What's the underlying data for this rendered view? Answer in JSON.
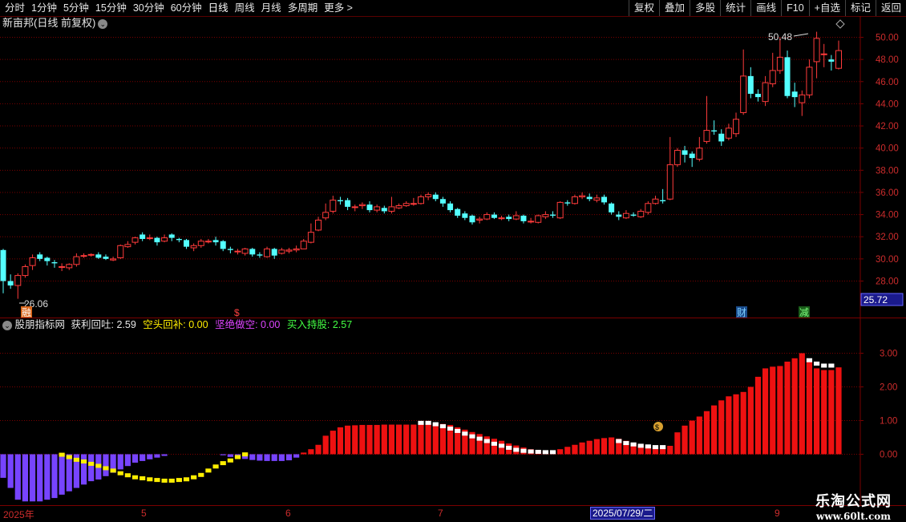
{
  "toolbar": {
    "periods": [
      "分时",
      "1分钟",
      "5分钟",
      "15分钟",
      "30分钟",
      "60分钟",
      "日线",
      "周线",
      "月线",
      "多周期",
      "更多 >"
    ],
    "right_buttons": [
      "复权",
      "叠加",
      "多股",
      "统计",
      "画线",
      "F10",
      "+自选",
      "标记",
      "返回"
    ]
  },
  "main_title": "新亩邦(日线 前复权)",
  "price_axis": {
    "ticks": [
      "50.00",
      "48.00",
      "46.00",
      "44.00",
      "42.00",
      "40.00",
      "38.00",
      "36.00",
      "34.00",
      "32.00",
      "30.00",
      "28.00"
    ],
    "current": "25.72"
  },
  "annotations": {
    "high": "50.48",
    "low": "26.06",
    "mark1": "融",
    "mark2": "$",
    "mark3": "财",
    "mark4": "减"
  },
  "indicator": {
    "name": "股朋指标网",
    "items": [
      {
        "label": "获利回吐:",
        "value": "2.59"
      },
      {
        "label": "空头回补:",
        "value": "0.00"
      },
      {
        "label": "坚绝做空:",
        "value": "0.00"
      },
      {
        "label": "买入持股:",
        "value": "2.57"
      }
    ],
    "axis": [
      "3.00",
      "2.00",
      "1.00",
      "0.00"
    ]
  },
  "date_axis": {
    "labels": [
      "2025年",
      "5",
      "6",
      "7",
      "9"
    ],
    "crosshair": "2025/07/29/二"
  },
  "watermark": {
    "line1": "乐淘公式网",
    "line2": "www.60lt.com"
  },
  "colors": {
    "up": "#ff3b3b",
    "down": "#54ffff",
    "purple": "#7744ff",
    "yellow": "#ffee00",
    "grid": "#7a0000"
  },
  "chart_data": {
    "type": "candlestick",
    "ylim": [
      26,
      51
    ],
    "candles": [
      [
        30.8,
        28.0,
        30.9,
        26.9
      ],
      [
        28.0,
        27.6,
        28.6,
        27.3
      ],
      [
        27.6,
        28.5,
        28.7,
        26.4
      ],
      [
        28.5,
        29.3,
        29.5,
        28.3
      ],
      [
        29.4,
        30.1,
        30.4,
        29.0
      ],
      [
        30.4,
        30.0,
        30.6,
        29.8
      ],
      [
        30.1,
        29.8,
        30.2,
        29.4
      ],
      [
        29.7,
        29.6,
        29.9,
        29.2
      ],
      [
        29.3,
        29.3,
        29.6,
        28.9
      ],
      [
        29.2,
        29.5,
        29.6,
        29.0
      ],
      [
        29.5,
        30.2,
        30.5,
        29.3
      ],
      [
        30.3,
        30.3,
        30.5,
        30.1
      ],
      [
        30.4,
        30.4,
        30.5,
        30.2
      ],
      [
        30.4,
        30.1,
        30.6,
        30.0
      ],
      [
        30.2,
        30.0,
        30.4,
        29.9
      ],
      [
        29.9,
        30.0,
        30.2,
        29.8
      ],
      [
        30.1,
        31.2,
        31.3,
        30.0
      ],
      [
        31.1,
        31.3,
        31.6,
        31.0
      ],
      [
        31.5,
        31.9,
        32.0,
        31.3
      ],
      [
        32.2,
        31.8,
        32.4,
        31.6
      ],
      [
        31.9,
        31.9,
        32.2,
        31.7
      ],
      [
        31.9,
        31.5,
        32.0,
        31.2
      ],
      [
        31.6,
        31.9,
        32.2,
        31.5
      ],
      [
        32.2,
        31.9,
        32.3,
        31.6
      ],
      [
        31.8,
        31.7,
        31.9,
        31.5
      ],
      [
        31.7,
        31.1,
        31.8,
        30.9
      ],
      [
        31.0,
        31.2,
        31.4,
        30.7
      ],
      [
        31.2,
        31.6,
        31.8,
        31.0
      ],
      [
        31.6,
        31.6,
        31.8,
        31.4
      ],
      [
        31.7,
        31.5,
        32.0,
        31.2
      ],
      [
        31.6,
        30.9,
        31.7,
        30.7
      ],
      [
        30.9,
        30.8,
        31.1,
        30.5
      ],
      [
        30.7,
        30.7,
        30.9,
        30.4
      ],
      [
        30.5,
        30.9,
        31.0,
        30.3
      ],
      [
        30.9,
        30.4,
        31.0,
        30.2
      ],
      [
        30.4,
        30.3,
        30.6,
        30.1
      ],
      [
        30.2,
        30.9,
        31.1,
        30.1
      ],
      [
        30.9,
        30.3,
        31.0,
        30.0
      ],
      [
        30.5,
        30.8,
        31.0,
        30.4
      ],
      [
        30.7,
        30.8,
        31.0,
        30.5
      ],
      [
        30.8,
        30.9,
        31.2,
        30.6
      ],
      [
        30.9,
        31.6,
        31.8,
        30.9
      ],
      [
        31.5,
        32.4,
        33.2,
        31.4
      ],
      [
        32.6,
        33.5,
        33.8,
        32.5
      ],
      [
        33.7,
        34.2,
        35.0,
        33.5
      ],
      [
        34.3,
        35.3,
        35.7,
        34.1
      ],
      [
        35.3,
        35.2,
        35.6,
        34.9
      ],
      [
        35.3,
        34.7,
        35.5,
        34.4
      ],
      [
        34.7,
        34.7,
        34.9,
        34.3
      ],
      [
        34.8,
        34.9,
        35.1,
        34.5
      ],
      [
        34.9,
        34.4,
        35.2,
        34.2
      ],
      [
        34.4,
        34.7,
        34.9,
        34.2
      ],
      [
        34.6,
        34.3,
        34.8,
        34.1
      ],
      [
        34.3,
        34.7,
        35.6,
        34.1
      ],
      [
        34.6,
        34.8,
        35.0,
        34.5
      ],
      [
        34.8,
        35.0,
        35.2,
        34.7
      ],
      [
        35.0,
        35.0,
        35.5,
        34.8
      ],
      [
        35.0,
        35.6,
        35.8,
        34.9
      ],
      [
        35.6,
        35.8,
        36.0,
        35.3
      ],
      [
        35.8,
        35.4,
        36.0,
        35.2
      ],
      [
        35.4,
        35.0,
        35.6,
        34.7
      ],
      [
        35.0,
        34.4,
        35.2,
        34.2
      ],
      [
        34.5,
        33.9,
        34.6,
        33.7
      ],
      [
        34.1,
        33.7,
        34.3,
        33.5
      ],
      [
        33.9,
        33.3,
        34.0,
        33.1
      ],
      [
        33.5,
        33.6,
        33.8,
        33.2
      ],
      [
        33.6,
        34.0,
        34.2,
        33.5
      ],
      [
        34.0,
        33.7,
        34.2,
        33.6
      ],
      [
        33.7,
        33.7,
        33.9,
        33.5
      ],
      [
        33.8,
        33.6,
        34.0,
        33.4
      ],
      [
        33.6,
        33.9,
        34.3,
        33.5
      ],
      [
        33.9,
        33.4,
        34.0,
        33.2
      ],
      [
        33.4,
        33.4,
        33.7,
        33.2
      ],
      [
        33.3,
        33.9,
        34.0,
        33.2
      ],
      [
        33.8,
        34.0,
        34.3,
        33.6
      ],
      [
        34.0,
        33.9,
        34.3,
        33.7
      ],
      [
        33.7,
        35.1,
        35.2,
        33.6
      ],
      [
        35.1,
        35.0,
        35.3,
        34.8
      ],
      [
        35.0,
        35.6,
        35.8,
        34.9
      ],
      [
        35.6,
        35.7,
        36.0,
        35.4
      ],
      [
        35.6,
        35.4,
        35.9,
        35.2
      ],
      [
        35.3,
        35.5,
        35.8,
        35.1
      ],
      [
        35.6,
        35.1,
        35.8,
        34.9
      ],
      [
        35.0,
        34.2,
        35.1,
        34.0
      ],
      [
        34.0,
        33.8,
        34.3,
        33.5
      ],
      [
        33.7,
        34.1,
        34.4,
        33.6
      ],
      [
        34.0,
        33.9,
        34.2,
        33.8
      ],
      [
        33.8,
        34.3,
        34.5,
        33.7
      ],
      [
        34.2,
        35.0,
        35.2,
        34.0
      ],
      [
        35.0,
        35.4,
        35.7,
        34.9
      ],
      [
        35.3,
        35.2,
        36.3,
        35.0
      ],
      [
        35.4,
        38.5,
        41.0,
        35.3
      ],
      [
        38.5,
        39.8,
        40.0,
        38.3
      ],
      [
        39.8,
        39.4,
        40.2,
        38.7
      ],
      [
        39.5,
        39.1,
        39.7,
        38.3
      ],
      [
        39.0,
        40.0,
        41.0,
        38.8
      ],
      [
        40.6,
        41.6,
        44.7,
        40.4
      ],
      [
        41.6,
        41.5,
        42.5,
        41.2
      ],
      [
        41.3,
        40.6,
        41.7,
        40.2
      ],
      [
        40.9,
        41.8,
        42.2,
        40.7
      ],
      [
        41.3,
        42.6,
        43.2,
        41.0
      ],
      [
        43.2,
        46.5,
        48.9,
        43.0
      ],
      [
        46.5,
        44.9,
        47.3,
        44.5
      ],
      [
        44.9,
        44.6,
        45.3,
        44.2
      ],
      [
        44.2,
        45.9,
        46.5,
        43.8
      ],
      [
        45.8,
        47.0,
        48.6,
        45.5
      ],
      [
        47.0,
        48.2,
        50.0,
        46.7
      ],
      [
        48.2,
        44.7,
        48.8,
        44.5
      ],
      [
        45.1,
        44.6,
        45.9,
        43.7
      ],
      [
        44.1,
        44.8,
        45.2,
        42.9
      ],
      [
        44.8,
        47.3,
        48.0,
        44.5
      ],
      [
        47.8,
        49.9,
        50.5,
        46.3
      ],
      [
        48.5,
        48.5,
        49.4,
        47.3
      ],
      [
        48.0,
        47.8,
        48.4,
        47.0
      ],
      [
        47.2,
        48.8,
        49.7,
        47.1
      ]
    ],
    "indicator_series": {
      "purple": [
        -0.7,
        -1.0,
        -1.35,
        -1.4,
        -1.4,
        -1.4,
        -1.35,
        -1.3,
        -1.2,
        -1.1,
        -1.0,
        -0.9,
        -0.8,
        -0.75,
        -0.65,
        -0.55,
        -0.45,
        -0.35,
        -0.25,
        -0.2,
        -0.15,
        -0.1,
        -0.05,
        0,
        0,
        0,
        0,
        0,
        0,
        0,
        -0.03,
        -0.08,
        -0.12,
        -0.14,
        -0.17,
        -0.19,
        -0.2,
        -0.2,
        -0.2,
        -0.18,
        -0.1,
        0
      ],
      "yellow": [
        0,
        0,
        0,
        0,
        0,
        0,
        0,
        0,
        -0.05,
        -0.12,
        -0.2,
        -0.25,
        -0.32,
        -0.38,
        -0.45,
        -0.52,
        -0.6,
        -0.66,
        -0.72,
        -0.75,
        -0.78,
        -0.8,
        -0.82,
        -0.82,
        -0.8,
        -0.78,
        -0.72,
        -0.65,
        -0.52,
        -0.4,
        -0.3,
        -0.22,
        -0.12,
        -0.04,
        0,
        0,
        0,
        0,
        0,
        0,
        0,
        0
      ],
      "red": [
        0,
        0,
        0,
        0,
        0,
        0,
        0,
        0,
        0,
        0,
        0,
        0,
        0,
        0,
        0,
        0,
        0,
        0,
        0,
        0,
        0,
        0,
        0,
        0,
        0,
        0,
        0,
        0,
        0,
        0,
        0,
        0,
        0,
        0,
        0,
        0,
        0,
        0,
        0,
        0,
        0,
        0.05,
        0.15,
        0.28,
        0.55,
        0.7,
        0.8,
        0.85,
        0.86,
        0.87,
        0.87,
        0.87,
        0.88,
        0.88,
        0.88,
        0.88,
        0.88,
        0.9,
        0.92,
        0.92,
        0.9,
        0.87,
        0.8,
        0.73,
        0.66,
        0.6,
        0.53,
        0.46,
        0.4,
        0.32,
        0.26,
        0.2,
        0.15,
        0.12,
        0.1,
        0.1,
        0.15,
        0.22,
        0.28,
        0.35,
        0.4,
        0.45,
        0.48,
        0.5,
        0.46,
        0.4,
        0.33,
        0.28,
        0.24,
        0.22,
        0.22,
        0.25,
        0.65,
        0.85,
        1.0,
        1.12,
        1.28,
        1.45,
        1.6,
        1.72,
        1.78,
        1.85,
        2.0,
        2.3,
        2.55,
        2.6,
        2.62,
        2.75,
        2.85,
        3.0,
        2.78,
        2.55,
        2.5,
        2.5,
        2.58,
        2.65,
        2.6,
        2.6
      ],
      "white": [
        0,
        0,
        0,
        0,
        0,
        0,
        0,
        0,
        0,
        0,
        0,
        0,
        0,
        0,
        0,
        0,
        0,
        0,
        0,
        0,
        0,
        0,
        0,
        0,
        0,
        0,
        0,
        0,
        0,
        0,
        0,
        0,
        0,
        0,
        0,
        0,
        0,
        0,
        0,
        0,
        0,
        0,
        0,
        0,
        0,
        0,
        0,
        0,
        0,
        0,
        0,
        0,
        0,
        0,
        0,
        0,
        0,
        0.92,
        0.92,
        0.88,
        0.82,
        0.75,
        0.68,
        0.6,
        0.52,
        0.45,
        0.38,
        0.3,
        0.24,
        0.18,
        0.12,
        0.09,
        0.07,
        0.06,
        0.05,
        0.05,
        0,
        0,
        0,
        0,
        0,
        0,
        0,
        0,
        0.38,
        0.32,
        0.28,
        0.24,
        0.22,
        0.2,
        0.2,
        0,
        0,
        0,
        0,
        0,
        0,
        0,
        0,
        0,
        0,
        0,
        0,
        0,
        0,
        0,
        0,
        0,
        0,
        0,
        2.78,
        2.68,
        2.62,
        2.62,
        0,
        0,
        0,
        0
      ]
    },
    "indicator_ylim": [
      -1.45,
      3.2
    ]
  }
}
